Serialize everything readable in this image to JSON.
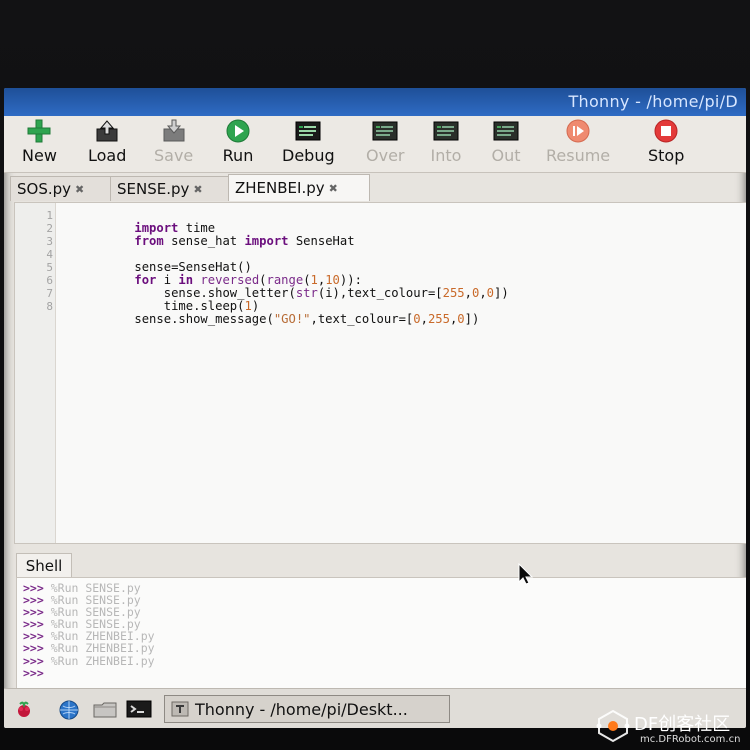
{
  "window": {
    "title": "Thonny  -  /home/pi/D"
  },
  "toolbar": {
    "items": [
      {
        "label": "New",
        "icon": "plus-icon",
        "enabled": true
      },
      {
        "label": "Load",
        "icon": "load-icon",
        "enabled": true
      },
      {
        "label": "Save",
        "icon": "save-icon",
        "enabled": false
      },
      {
        "label": "Run",
        "icon": "run-icon",
        "enabled": true
      },
      {
        "label": "Debug",
        "icon": "debug-icon",
        "enabled": true
      },
      {
        "label": "Over",
        "icon": "step-over-icon",
        "enabled": false
      },
      {
        "label": "Into",
        "icon": "step-into-icon",
        "enabled": false
      },
      {
        "label": "Out",
        "icon": "step-out-icon",
        "enabled": false
      },
      {
        "label": "Resume",
        "icon": "resume-icon",
        "enabled": false
      },
      {
        "label": "Stop",
        "icon": "stop-icon",
        "enabled": true
      }
    ]
  },
  "tabs": {
    "items": [
      {
        "label": "SOS.py",
        "close": "✖",
        "active": false
      },
      {
        "label": "SENSE.py",
        "close": "✖",
        "active": false
      },
      {
        "label": "ZHENBEI.py",
        "close": "✖",
        "active": true
      }
    ]
  },
  "editor": {
    "line_numbers": [
      "1",
      "2",
      "3",
      "4",
      "5",
      "6",
      "7",
      "8"
    ],
    "lines": [
      "import time",
      "from sense_hat import SenseHat",
      "",
      "sense=SenseHat()",
      "for i in reversed(range(1,10)):",
      "    sense.show_letter(str(i),text_colour=[255,0,0])",
      "    time.sleep(1)",
      "sense.show_message(\"GO!\",text_colour=[0,255,0])"
    ]
  },
  "shell": {
    "tab_label": "Shell",
    "prompt": ">>>",
    "lines": [
      "%Run SENSE.py",
      "%Run SENSE.py",
      "%Run SENSE.py",
      "%Run SENSE.py",
      "%Run ZHENBEI.py",
      "%Run ZHENBEI.py",
      "%Run ZHENBEI.py",
      ""
    ]
  },
  "taskbar": {
    "icons": [
      "raspberry-icon",
      "globe-icon",
      "folder-icon",
      "terminal-icon"
    ],
    "task_label": "Thonny  -  /home/pi/Deskt..."
  },
  "watermark": {
    "title": "DF创客社区",
    "subtitle": "mc.DFRobot.com.cn"
  },
  "colors": {
    "titlebar": "#2f6bc4",
    "keyword": "#6b0e7d",
    "number": "#c96a2a",
    "prompt": "#7a2a89",
    "run_green": "#2ea44f",
    "stop_red": "#e33a3a"
  }
}
